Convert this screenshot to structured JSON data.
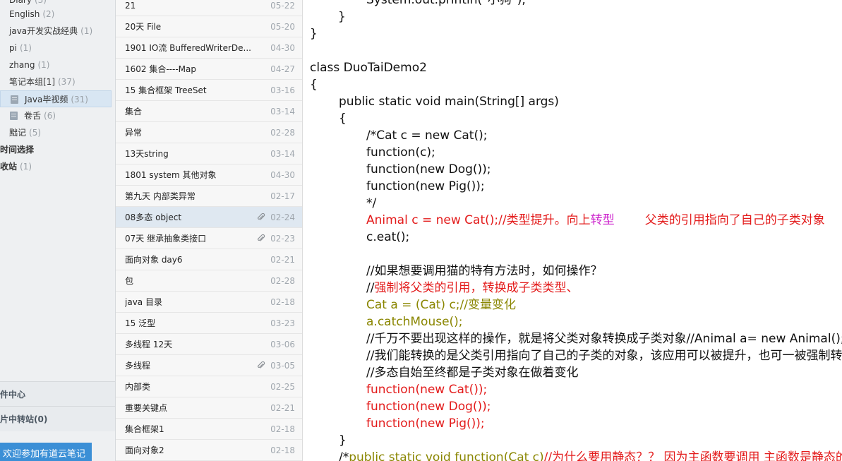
{
  "sidebar": {
    "items": [
      {
        "label": "Diary",
        "count": "(3)"
      },
      {
        "label": "English",
        "count": "(2)"
      },
      {
        "label": "java开发实战经典",
        "count": "(1)"
      },
      {
        "label": "pi",
        "count": "(1)"
      },
      {
        "label": "zhang",
        "count": "(1)"
      },
      {
        "label": "笔记本组[1]",
        "count": "(37)"
      },
      {
        "label": "Java毕视频",
        "count": "(31)"
      },
      {
        "label": "卷舌",
        "count": "(6)"
      },
      {
        "label": "黜记",
        "count": "(5)"
      },
      {
        "label": "时间选择",
        "count": ""
      },
      {
        "label": "收站",
        "count": "(1)"
      }
    ],
    "sections": [
      "件中心",
      "片中转站(0)"
    ],
    "promo_label": "欢迎参加有道云笔记"
  },
  "notes": [
    {
      "title": "21",
      "date": "05-22",
      "clip": false
    },
    {
      "title": "20天 File",
      "date": "05-20",
      "clip": false
    },
    {
      "title": "1901  IO流 BufferedWriterDe...",
      "date": "04-30",
      "clip": false
    },
    {
      "title": "1602 集合----Map",
      "date": "04-27",
      "clip": false
    },
    {
      "title": "15 集合框架 TreeSet",
      "date": "03-16",
      "clip": false
    },
    {
      "title": "集合",
      "date": "03-14",
      "clip": false
    },
    {
      "title": "异常",
      "date": "02-28",
      "clip": false
    },
    {
      "title": "13天string",
      "date": "03-14",
      "clip": false
    },
    {
      "title": "1801 system 其他对象",
      "date": "04-30",
      "clip": false
    },
    {
      "title": "第九天 内部类异常",
      "date": "02-17",
      "clip": false
    },
    {
      "title": "08多态 object",
      "date": "02-24",
      "clip": true
    },
    {
      "title": "07天  继承抽象类接口",
      "date": "02-23",
      "clip": true
    },
    {
      "title": "面向对象 day6",
      "date": "02-21",
      "clip": false
    },
    {
      "title": "包",
      "date": "02-28",
      "clip": false
    },
    {
      "title": "java 目录",
      "date": "02-18",
      "clip": false
    },
    {
      "title": "15 泛型",
      "date": "03-23",
      "clip": false
    },
    {
      "title": "多线程  12天",
      "date": "03-06",
      "clip": false
    },
    {
      "title": "多线程",
      "date": "03-05",
      "clip": true
    },
    {
      "title": "内部类",
      "date": "02-25",
      "clip": false
    },
    {
      "title": "重要关键点",
      "date": "02-21",
      "clip": false
    },
    {
      "title": "集合框架1",
      "date": "02-18",
      "clip": false
    },
    {
      "title": "面向对象2",
      "date": "02-18",
      "clip": false
    }
  ],
  "editor": {
    "lines": [
      [
        {
          "t": "System.out.println(\"小狗\");",
          "c": "black"
        }
      ],
      [
        {
          "t": "}",
          "c": "black"
        }
      ],
      [
        {
          "t": "}",
          "c": "black"
        }
      ],
      [],
      [
        {
          "t": "class DuoTaiDemo2",
          "c": "black"
        }
      ],
      [
        {
          "t": "{",
          "c": "black"
        }
      ],
      [
        {
          "t": "public static void main(String[] args)",
          "c": "black"
        }
      ],
      [
        {
          "t": "{",
          "c": "black"
        }
      ],
      [
        {
          "t": "/*Cat c = new Cat();",
          "c": "black"
        }
      ],
      [
        {
          "t": "function(c);",
          "c": "black"
        }
      ],
      [
        {
          "t": "function(new Dog());",
          "c": "black"
        }
      ],
      [
        {
          "t": "function(new Pig());",
          "c": "black"
        }
      ],
      [
        {
          "t": "*/",
          "c": "black"
        }
      ],
      [
        {
          "t": "Animal c = new Cat();//类型提升。向上",
          "c": "red"
        },
        {
          "t": "转型",
          "c": "magenta"
        },
        {
          "t": "        父类的引用指向了自己的子类对象",
          "c": "red"
        }
      ],
      [
        {
          "t": "c.eat();",
          "c": "black"
        }
      ],
      [],
      [
        {
          "t": "//如果想要调用猫的特有方法时，如何操作？",
          "c": "black"
        }
      ],
      [
        {
          "t": "//",
          "c": "black"
        },
        {
          "t": "强制将父类的引用，转换成子类类型、",
          "c": "red"
        }
      ],
      [
        {
          "t": "Cat a = (Cat) c;//变量变化",
          "c": "olive"
        }
      ],
      [
        {
          "t": "a.catchMouse();",
          "c": "olive"
        }
      ],
      [
        {
          "t": "//千万不要出现这样的操作，就是将父类对象转换成子类对象//Animal a= new Animal();",
          "c": "black"
        }
      ],
      [
        {
          "t": "//我们能转换的是父类引用指向了自己的子类的对象，该应用可以被提升，也可一被强制转换。",
          "c": "black"
        }
      ],
      [
        {
          "t": "//多态自始至终都是子类对象在做着变化",
          "c": "black"
        }
      ],
      [
        {
          "t": "function(new Cat());",
          "c": "red"
        }
      ],
      [
        {
          "t": "function(new Dog());",
          "c": "red"
        }
      ],
      [
        {
          "t": "function(new Pig());",
          "c": "red"
        }
      ],
      [
        {
          "t": "}",
          "c": "black"
        }
      ],
      [
        {
          "t": "/*",
          "c": "black"
        },
        {
          "t": "public static void function(Cat c)",
          "c": "olive"
        },
        {
          "t": "//为什么要用静态？？ 因为主函数要调用 主函数是静态的",
          "c": "red"
        }
      ]
    ]
  }
}
